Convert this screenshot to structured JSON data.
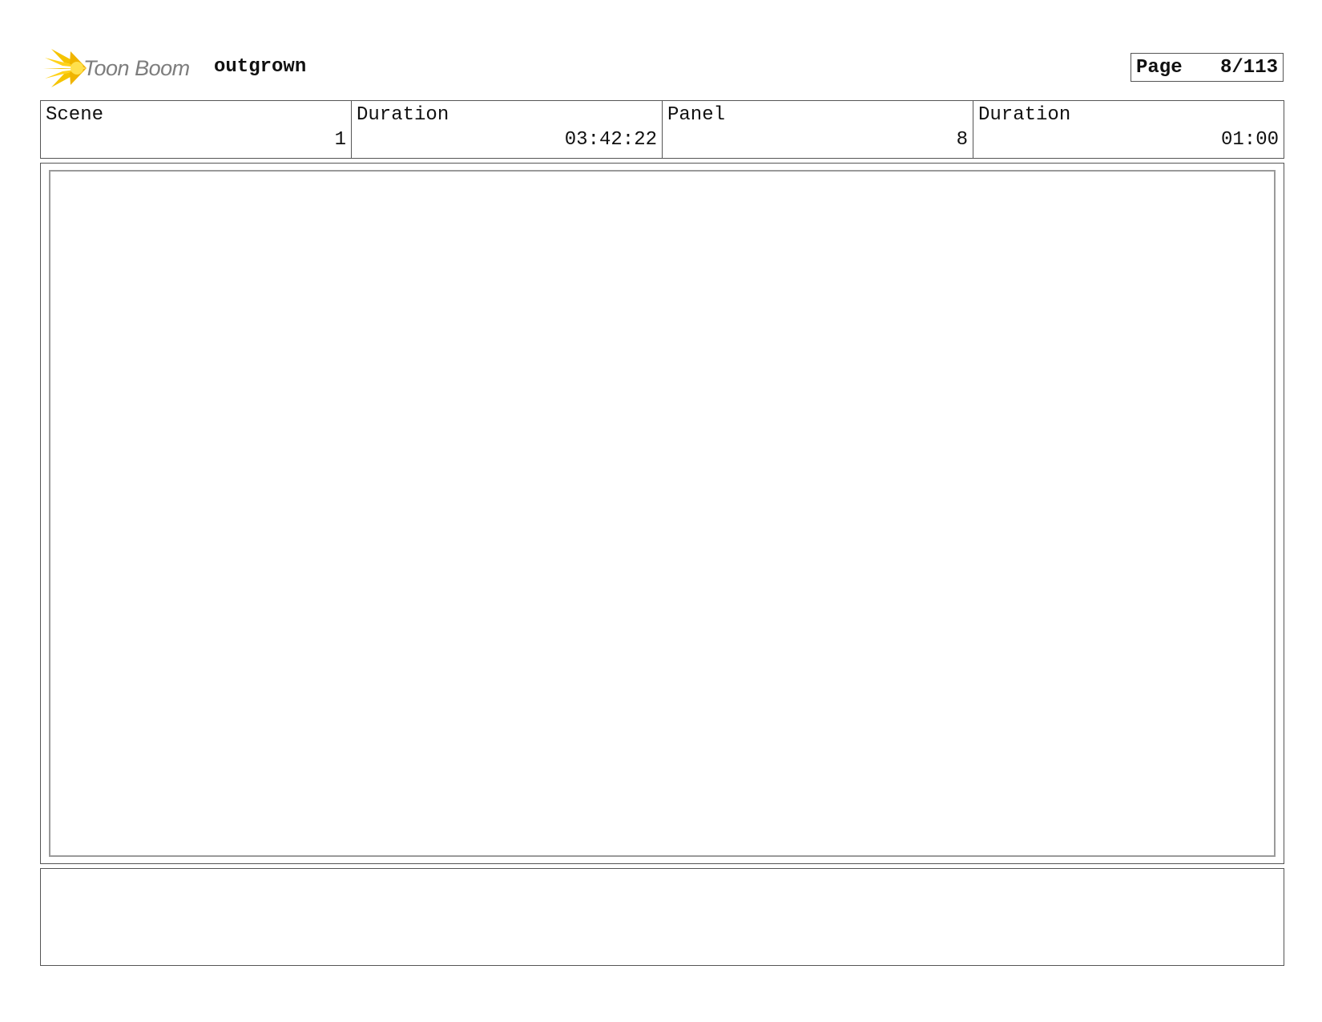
{
  "header": {
    "logo_text": "Toon Boom",
    "logo_icon": "starburst-logo-icon",
    "project_title": "outgrown",
    "page_label": "Page",
    "page_value": "8/113"
  },
  "info": {
    "scene_label": "Scene",
    "scene_value": "1",
    "scene_duration_label": "Duration",
    "scene_duration_value": "03:42:22",
    "panel_label": "Panel",
    "panel_value": "8",
    "panel_duration_label": "Duration",
    "panel_duration_value": "01:00"
  },
  "colors": {
    "logo_yellow": "#f5c400",
    "logo_gray": "#7d7d7d",
    "border": "#555555",
    "panel_border": "#9a9a9a"
  }
}
